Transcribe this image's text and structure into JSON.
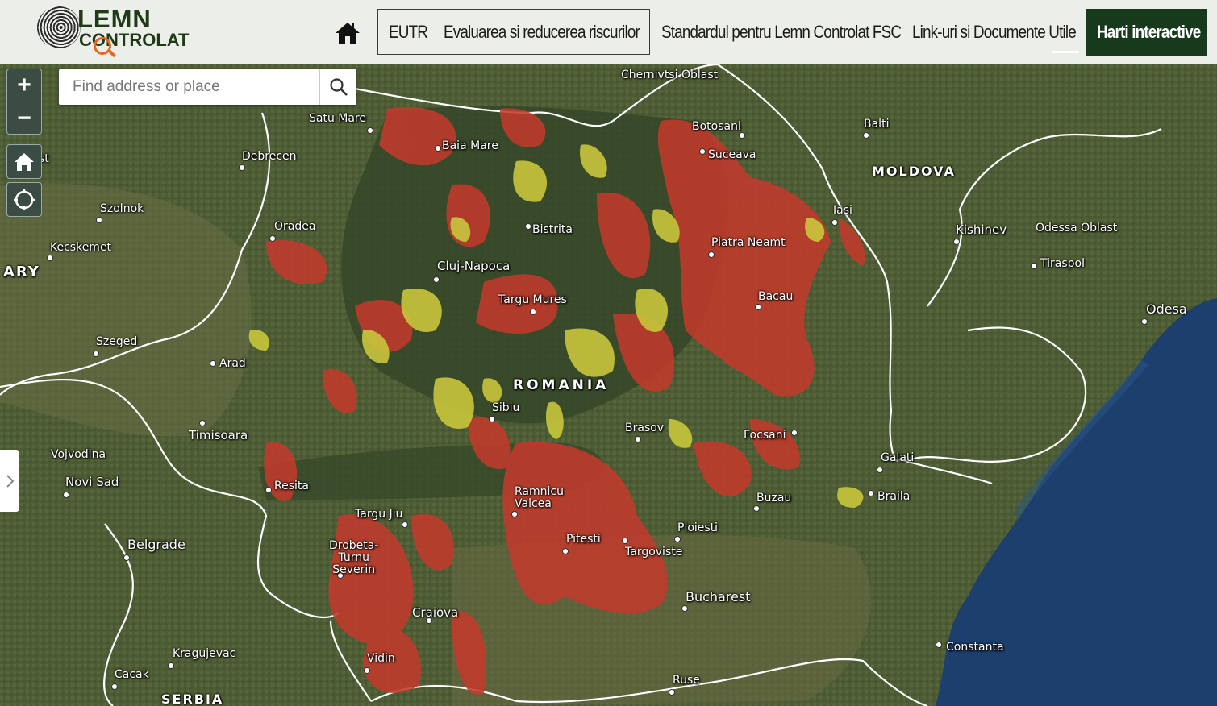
{
  "header": {
    "logo": {
      "line1": "LEMN",
      "line2": "CONTROLAT"
    },
    "nav": [
      {
        "label": "EUTR"
      },
      {
        "label": "Evaluarea si reducerea riscurilor"
      },
      {
        "label": "Standardul pentru Lemn Controlat FSC"
      },
      {
        "label": "Link-uri si Documente Utile"
      },
      {
        "label": "Harti interactive",
        "active": true
      }
    ],
    "home_icon": "home-icon"
  },
  "map": {
    "search_placeholder": "Find address or place",
    "controls": {
      "zoom_in": "+",
      "zoom_out": "−"
    },
    "colors": {
      "high_risk": "#c0392b",
      "medium_risk": "#c8c83a",
      "sea": "#1d3f6e",
      "land": "#4a5a33"
    },
    "labels": {
      "ukraine_oblast": "Chernivtsi Oblast",
      "satu_mare": "Satu Mare",
      "baia_mare": "Baia Mare",
      "botosani": "Botosani",
      "suceava": "Suceava",
      "balti": "Balti",
      "moldova": "MOLDOVA",
      "debrecen": "Debrecen",
      "szolnok": "Szolnok",
      "oradea": "Oradea",
      "bistrita": "Bistrita",
      "iasi": "Iasi",
      "kishinev": "Kishinev",
      "odessa_oblast": "Odessa Oblast",
      "kecskemet": "Kecskemet",
      "hungary_part": "ARY",
      "cluj": "Cluj-Napoca",
      "piatra_neamt": "Piatra Neamt",
      "tiraspol": "Tiraspol",
      "targu_mures": "Targu Mures",
      "bacau": "Bacau",
      "odesa": "Odesa",
      "szeged": "Szeged",
      "arad": "Arad",
      "romania": "ROMANIA",
      "sibiu": "Sibiu",
      "timisoara": "Timisoara",
      "brasov": "Brasov",
      "focsani": "Focsani",
      "vojvodina": "Vojvodina",
      "galati": "Galati",
      "novi_sad": "Novi Sad",
      "resita": "Resita",
      "ramnicu": "Ramnicu\nValcea",
      "braila": "Braila",
      "buzau": "Buzau",
      "targu_jiu": "Targu Jiu",
      "ploiesti": "Ploiesti",
      "drobeta": "Drobeta-\nTurnu\nSeverin",
      "pitesti": "Pitesti",
      "targoviste": "Targoviste",
      "belgrade": "Belgrade",
      "bucharest": "Bucharest",
      "craiova": "Craiova",
      "kragujevac": "Kragujevac",
      "constanta": "Constanta",
      "vidin": "Vidin",
      "cacak": "Cacak",
      "ruse": "Ruse",
      "serbia": "SERBIA",
      "hungary_cut": "st"
    }
  }
}
